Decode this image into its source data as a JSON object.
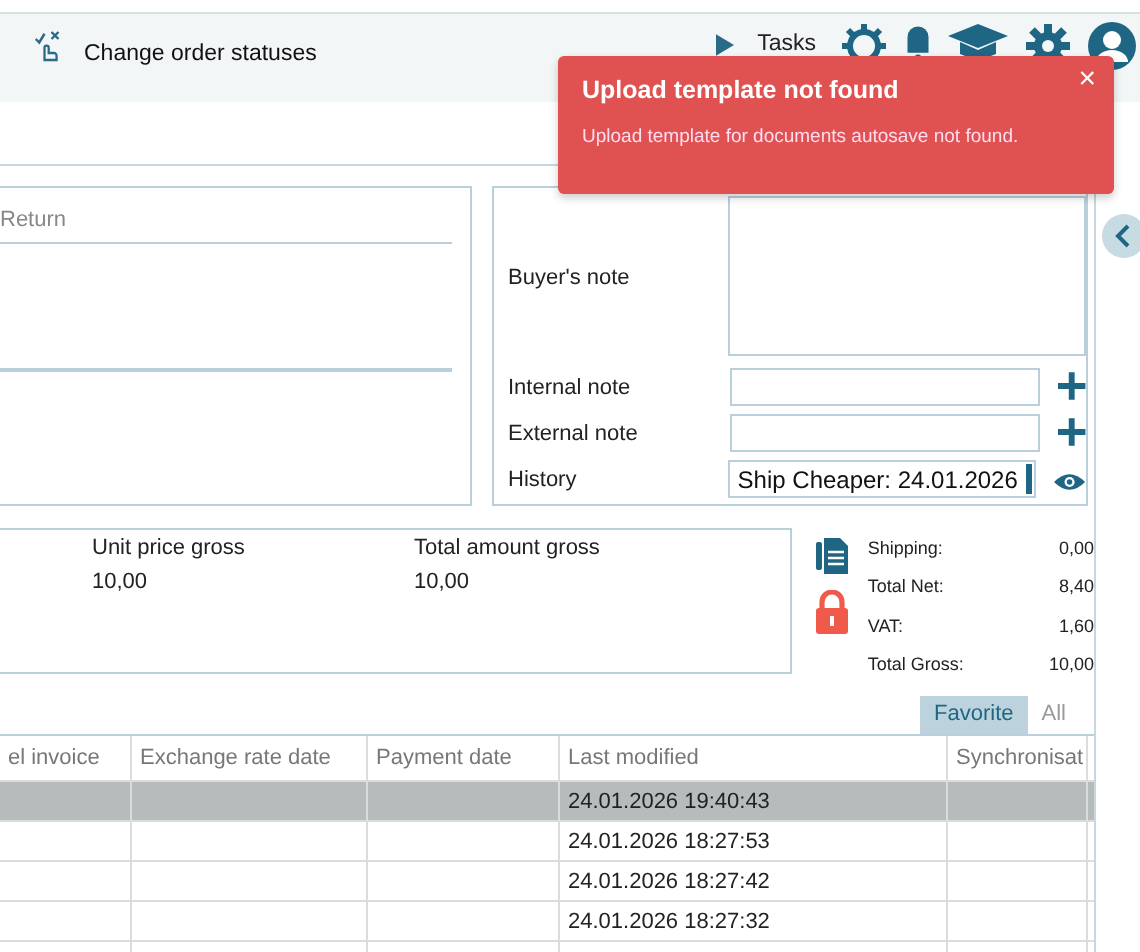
{
  "toolbar": {
    "actions": [
      {
        "label": "Change order statuses"
      }
    ],
    "tasks_label": "Tasks"
  },
  "notification": {
    "title": "Upload template not found",
    "message": "Upload template for documents autosave not found.",
    "close": "×"
  },
  "return_field": {
    "placeholder": "Return"
  },
  "notes": [
    {
      "kind": "textarea",
      "label": "Buyer's note"
    },
    {
      "kind": "add",
      "label": "Internal note"
    },
    {
      "kind": "add",
      "label": "External note"
    },
    {
      "kind": "view",
      "label": "History",
      "value": "Ship Cheaper: 24.01.2026"
    }
  ],
  "item": {
    "columns": [
      {
        "label": "Unit price gross",
        "value": "10,00"
      },
      {
        "label": "Total amount gross",
        "value": "10,00"
      }
    ]
  },
  "summary": [
    {
      "label": "Shipping:",
      "value": "0,00"
    },
    {
      "label": "Total Net:",
      "value": "8,40"
    },
    {
      "label": "VAT:",
      "value": "1,60"
    },
    {
      "label": "Total Gross:",
      "value": "10,00"
    }
  ],
  "view_tabs": [
    {
      "label": "Favorite",
      "selected": true
    },
    {
      "label": "All",
      "selected": false
    }
  ],
  "table": {
    "columns": [
      "el invoice",
      "Exchange rate date",
      "Payment date",
      "Last modified",
      "Synchronisat"
    ],
    "rows": [
      {
        "selected": true,
        "last_modified": "24.01.2026 19:40:43"
      },
      {
        "selected": false,
        "last_modified": "24.01.2026 18:27:53"
      },
      {
        "selected": false,
        "last_modified": "24.01.2026 18:27:42"
      },
      {
        "selected": false,
        "last_modified": "24.01.2026 18:27:32"
      }
    ]
  }
}
